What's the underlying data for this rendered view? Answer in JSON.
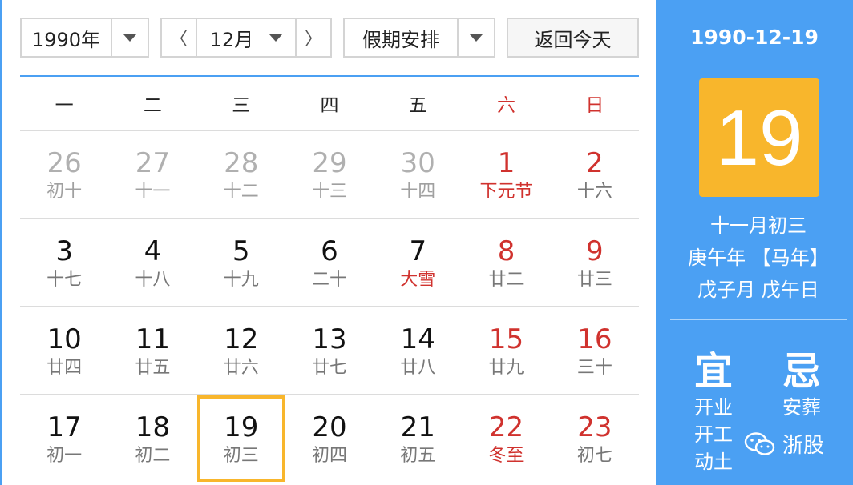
{
  "controls": {
    "year": "1990年",
    "month": "12月",
    "holiday": "假期安排",
    "today_btn": "返回今天",
    "prev_arrow": "〈",
    "next_arrow": "〉"
  },
  "weekdays": [
    "一",
    "二",
    "三",
    "四",
    "五",
    "六",
    "日"
  ],
  "weeks": [
    [
      {
        "day": "26",
        "lunar": "初十"
      },
      {
        "day": "27",
        "lunar": "十一"
      },
      {
        "day": "28",
        "lunar": "十二"
      },
      {
        "day": "29",
        "lunar": "十三"
      },
      {
        "day": "30",
        "lunar": "十四"
      },
      {
        "day": "1",
        "lunar": "下元节"
      },
      {
        "day": "2",
        "lunar": "十六"
      }
    ],
    [
      {
        "day": "3",
        "lunar": "十七"
      },
      {
        "day": "4",
        "lunar": "十八"
      },
      {
        "day": "5",
        "lunar": "十九"
      },
      {
        "day": "6",
        "lunar": "二十"
      },
      {
        "day": "7",
        "lunar": "大雪"
      },
      {
        "day": "8",
        "lunar": "廿二"
      },
      {
        "day": "9",
        "lunar": "廿三"
      }
    ],
    [
      {
        "day": "10",
        "lunar": "廿四"
      },
      {
        "day": "11",
        "lunar": "廿五"
      },
      {
        "day": "12",
        "lunar": "廿六"
      },
      {
        "day": "13",
        "lunar": "廿七"
      },
      {
        "day": "14",
        "lunar": "廿八"
      },
      {
        "day": "15",
        "lunar": "廿九"
      },
      {
        "day": "16",
        "lunar": "三十"
      }
    ],
    [
      {
        "day": "17",
        "lunar": "初一"
      },
      {
        "day": "18",
        "lunar": "初二"
      },
      {
        "day": "19",
        "lunar": "初三"
      },
      {
        "day": "20",
        "lunar": "初四"
      },
      {
        "day": "21",
        "lunar": "初五"
      },
      {
        "day": "22",
        "lunar": "冬至"
      },
      {
        "day": "23",
        "lunar": "初七"
      }
    ]
  ],
  "info": {
    "date": "1990-12-19",
    "big_day": "19",
    "lunar_date": "十一月初三",
    "year_ganzhi": "庚午年 【马年】",
    "month_day_ganzhi": "戊子月 戊午日",
    "yi_label": "宜",
    "ji_label": "忌",
    "yi_items": [
      "开业",
      "开工",
      "动土"
    ],
    "ji_items": [
      "安葬"
    ],
    "brand": "浙股"
  },
  "colors": {
    "accent_blue": "#4ba0f3",
    "highlight_orange": "#f8b62c",
    "weekend_red": "#d0322e"
  }
}
